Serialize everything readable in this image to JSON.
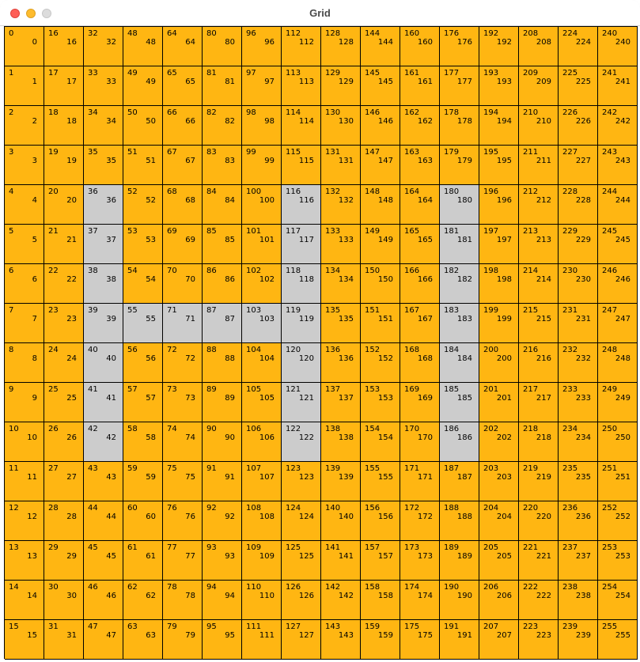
{
  "window": {
    "title": "Grid"
  },
  "colors": {
    "cell_default": "#ffb612",
    "cell_highlight": "#cccccc",
    "gridline": "#000000"
  },
  "grid": {
    "rows": 16,
    "cols": 16,
    "order": "column-major",
    "count": 256,
    "highlighted": [
      36,
      37,
      38,
      39,
      40,
      41,
      42,
      55,
      71,
      87,
      103,
      116,
      117,
      118,
      119,
      120,
      121,
      122,
      180,
      181,
      182,
      183,
      184,
      185,
      186
    ]
  }
}
